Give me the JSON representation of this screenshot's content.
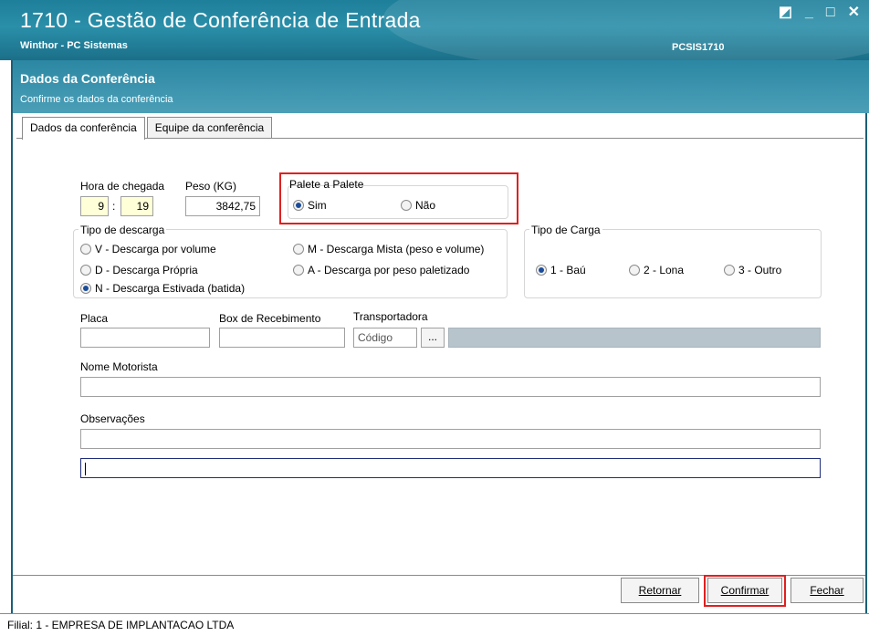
{
  "window": {
    "title": "1710 - Gestão de Conferência de Entrada",
    "company": "Winthor - PC Sistemas",
    "code": "PCSIS1710",
    "controls": {
      "restore": "◩",
      "minimize": "_",
      "maximize": "□",
      "close": "✕"
    }
  },
  "header": {
    "title": "Dados da Conferência",
    "subtitle": "Confirme os dados da conferência"
  },
  "tabs": [
    {
      "label": "Dados da conferência",
      "active": true
    },
    {
      "label": "Equipe da conferência",
      "active": false
    }
  ],
  "form": {
    "hora_chegada": {
      "label": "Hora de chegada",
      "hour": "9",
      "separator": ":",
      "minute": "19"
    },
    "peso": {
      "label": "Peso (KG)",
      "value": "3842,75"
    },
    "palete": {
      "title": "Palete a Palete",
      "options": [
        {
          "label": "Sim",
          "selected": true
        },
        {
          "label": "Não",
          "selected": false
        }
      ]
    },
    "tipo_descarga": {
      "title": "Tipo de descarga",
      "options": [
        {
          "label": "V - Descarga por volume",
          "selected": false
        },
        {
          "label": "M - Descarga Mista (peso e volume)",
          "selected": false
        },
        {
          "label": "D - Descarga Própria",
          "selected": false
        },
        {
          "label": "A - Descarga por peso paletizado",
          "selected": false
        },
        {
          "label": "N - Descarga Estivada (batida)",
          "selected": true
        }
      ]
    },
    "tipo_carga": {
      "title": "Tipo de Carga",
      "options": [
        {
          "label": "1 - Baú",
          "selected": true
        },
        {
          "label": "2 - Lona",
          "selected": false
        },
        {
          "label": "3 - Outro",
          "selected": false
        }
      ]
    },
    "placa": {
      "label": "Placa",
      "value": ""
    },
    "box": {
      "label": "Box de Recebimento",
      "value": ""
    },
    "transportadora": {
      "label": "Transportadora",
      "placeholder": "Código",
      "lookup": "...",
      "name": ""
    },
    "motorista": {
      "label": "Nome Motorista",
      "value": ""
    },
    "observacoes": {
      "label": "Observações",
      "line1": "",
      "line2": ""
    }
  },
  "buttons": {
    "retornar": "Retornar",
    "confirmar": "Confirmar",
    "fechar": "Fechar"
  },
  "status": {
    "text": "Filial: 1 - EMPRESA DE IMPLANTACAO LTDA"
  },
  "colors": {
    "titlebar": "#1e7f9a",
    "header": "#2b87a3",
    "highlight": "#e02020"
  }
}
